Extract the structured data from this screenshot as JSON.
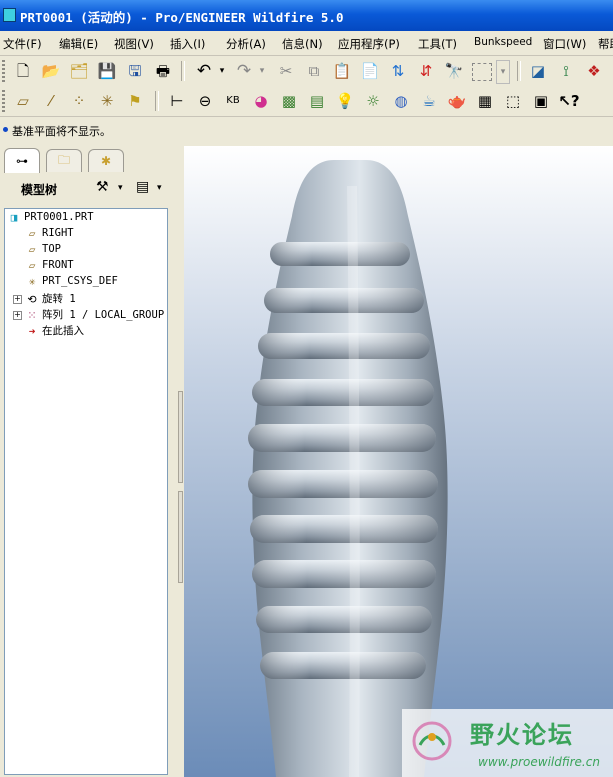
{
  "window": {
    "title": "PRT0001 (活动的) - Pro/ENGINEER Wildfire 5.0"
  },
  "menu": [
    "文件(F)",
    "编辑(E)",
    "视图(V)",
    "插入(I)",
    "分析(A)",
    "信息(N)",
    "应用程序(P)",
    "工具(T)",
    "Bunkspeed",
    "窗口(W)",
    "帮助"
  ],
  "toolbar_row1": [
    "new-file-icon",
    "open-folder-icon",
    "open-session-icon",
    "save-icon",
    "save-copy-icon",
    "print-icon",
    "undo-icon",
    "redo-icon",
    "cut-icon",
    "copy-icon",
    "paste-icon",
    "paste-special-icon",
    "regenerate-icon",
    "regen-manager-icon",
    "find-icon",
    "select-box-icon",
    "dropdown-icon",
    "repaint-icon",
    "orient-icon",
    "named-view-icon"
  ],
  "toolbar_row2": [
    "datum-plane-display-icon",
    "datum-axis-display-icon",
    "datum-point-display-icon",
    "csys-display-icon",
    "annotation-display-icon",
    "measure-icon",
    "area-icon",
    "section-icon",
    "curvature-icon",
    "gauss-icon",
    "lights-icon",
    "glow-icon",
    "scene-icon",
    "appearance-icon",
    "perspective-icon",
    "teapot-icon",
    "model-info-icon",
    "view-manager-icon",
    "layer-icon",
    "context-help-icon"
  ],
  "status": {
    "message": "基准平面将不显示。"
  },
  "model_tree": {
    "label": "模型树",
    "items": [
      {
        "name": "PRT0001.PRT",
        "icon": "part-icon"
      },
      {
        "name": "RIGHT",
        "icon": "datum-plane-icon"
      },
      {
        "name": "TOP",
        "icon": "datum-plane-icon"
      },
      {
        "name": "FRONT",
        "icon": "datum-plane-icon"
      },
      {
        "name": "PRT_CSYS_DEF",
        "icon": "coordinate-system-icon"
      },
      {
        "name": "旋转 1",
        "icon": "revolve-icon"
      },
      {
        "name": "阵列 1 / LOCAL_GROUP",
        "icon": "pattern-icon"
      },
      {
        "name": "在此插入",
        "icon": "insert-here-arrow-icon"
      }
    ]
  },
  "colors": {
    "titlebar": "#0a5ad8",
    "viewport_top": "#ffffff",
    "viewport_bottom": "#6b8cb8",
    "model_surface": "#b9c4cf"
  },
  "watermark": {
    "title": "野火论坛",
    "url": "www.proewildfire.cn"
  }
}
